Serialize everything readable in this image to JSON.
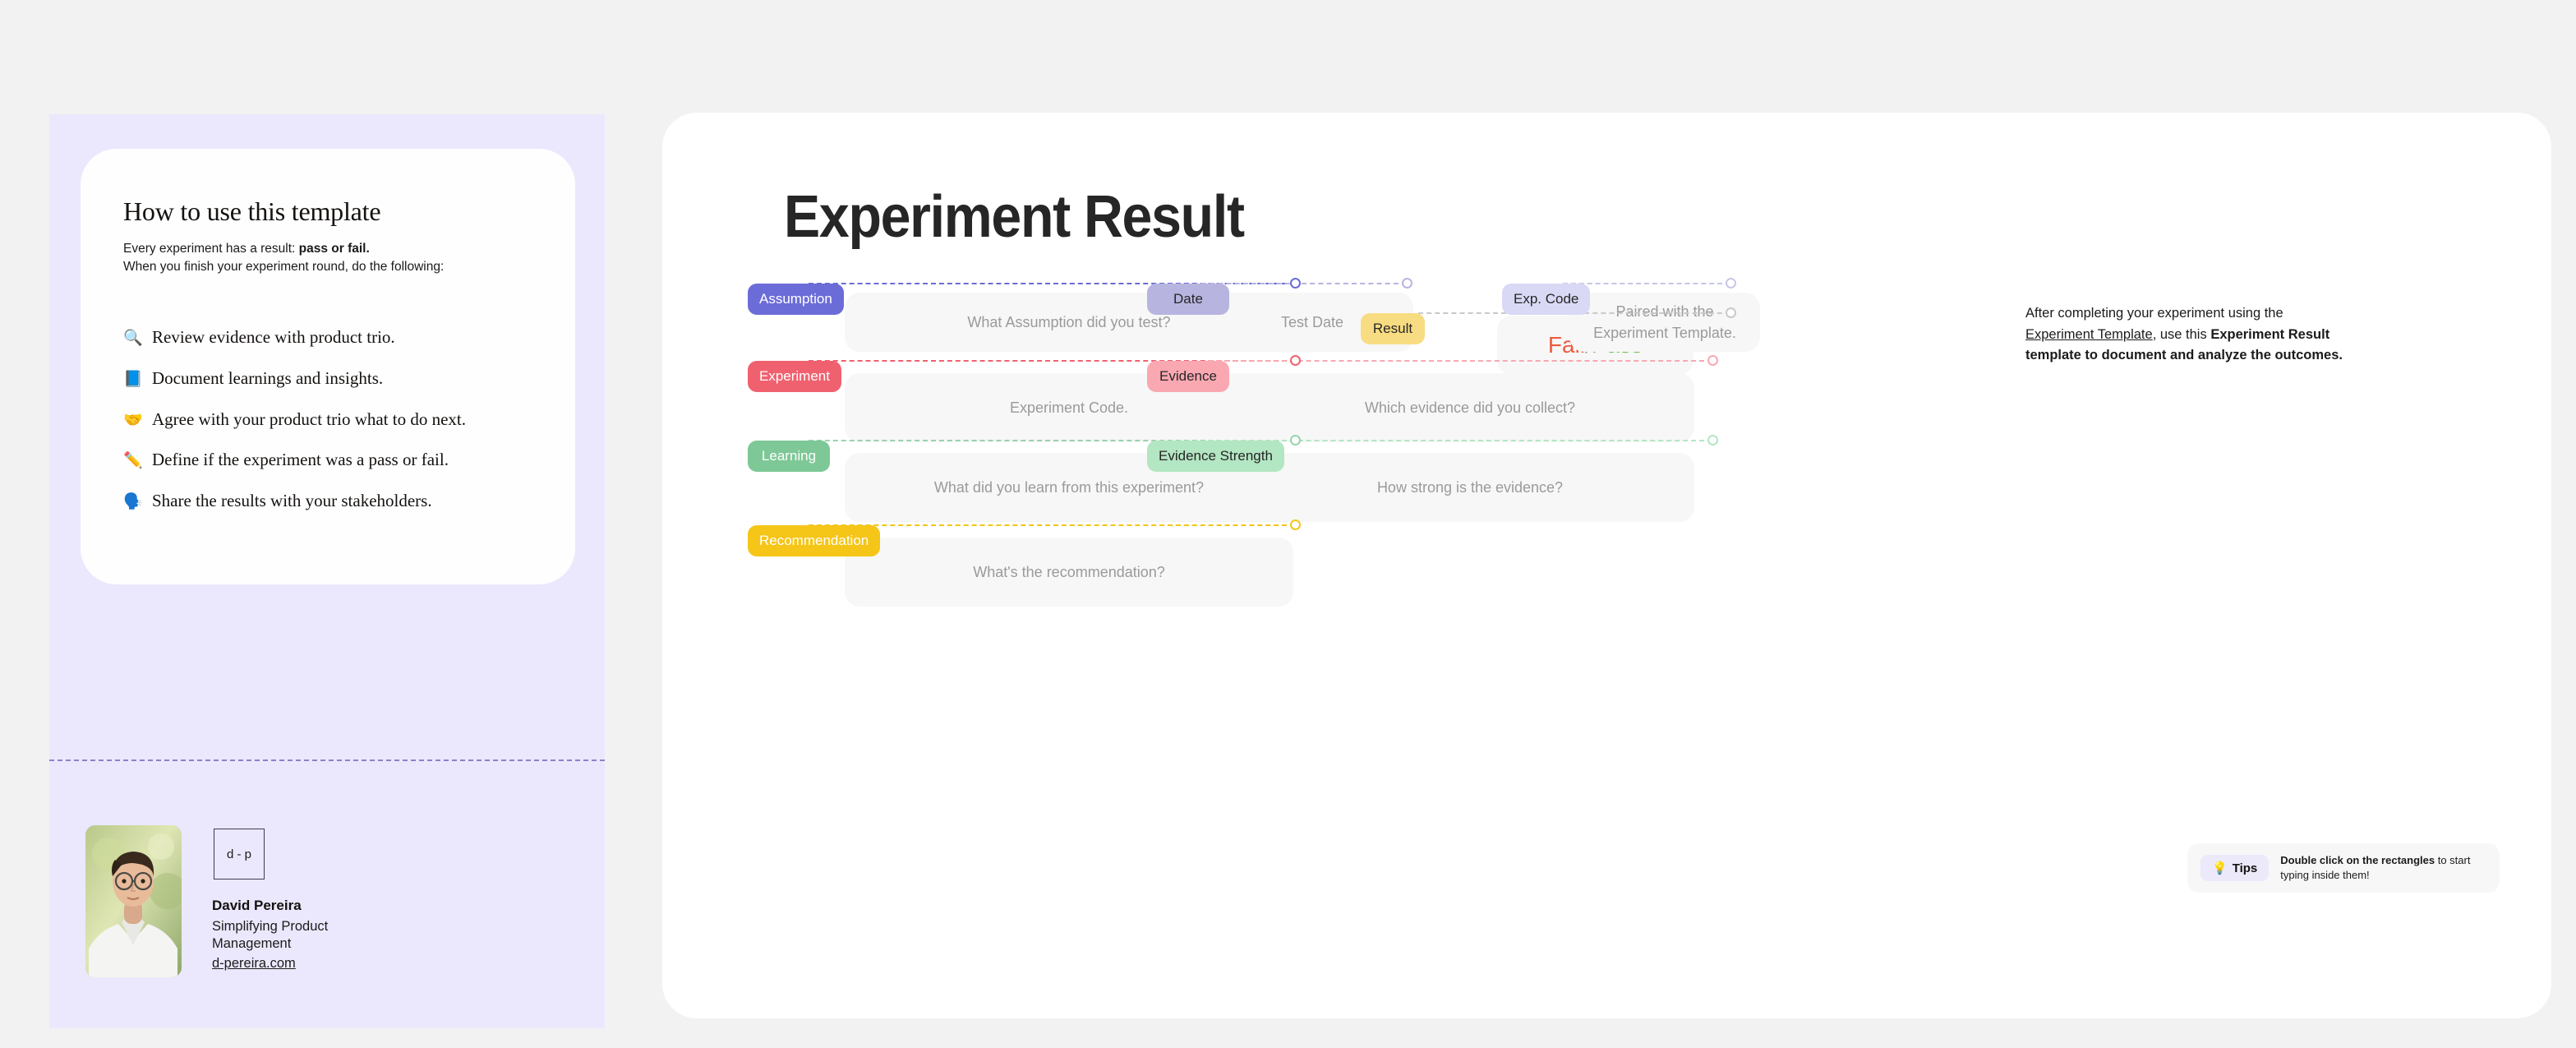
{
  "left_panel": {
    "howto": {
      "title": "How to use this template",
      "sub_line1_prefix": "Every experiment has a result: ",
      "sub_line1_bold": "pass or fail.",
      "sub_line2": "When you finish your experiment round, do the following:",
      "steps": [
        {
          "emoji": "🔍",
          "icon_name": "magnifier-icon",
          "text": "Review evidence with product trio."
        },
        {
          "emoji": "📘",
          "icon_name": "blue-book-icon",
          "text": "Document learnings and insights."
        },
        {
          "emoji": "🤝",
          "icon_name": "handshake-icon",
          "text": "Agree with your product trio what to do next."
        },
        {
          "emoji": "✏️",
          "icon_name": "pencil-icon",
          "text": "Define if the experiment was a pass or fail."
        },
        {
          "emoji": "🗣️",
          "icon_name": "speaking-head-icon",
          "text": "Share the results with your stakeholders."
        }
      ]
    },
    "author": {
      "logo_text": "d - p",
      "name": "David Pereira",
      "role": "Simplifying Product Management",
      "link": "d-pereira.com"
    }
  },
  "main": {
    "title": "Experiment Result",
    "intro": {
      "line1": "After completing your experiment using the",
      "link": "Experiment Template",
      "mid": ", use this ",
      "bold1": "Experiment Result",
      "bold2": "template to document and analyze the outcomes."
    },
    "result": {
      "label": "Result",
      "fail": "Fail",
      "separator": "/",
      "pass": "Pass"
    },
    "fields": [
      {
        "id": "assumption",
        "label": "Assumption",
        "placeholder": "What Assumption did you test?",
        "pill_bg": "#6c6cd8",
        "pill_color": "#ffffff",
        "line_color": "#6c6cd8",
        "column": "left",
        "row": 1
      },
      {
        "id": "date",
        "label": "Date",
        "placeholder": "Test Date",
        "pill_bg": "#b8b4e0",
        "pill_color": "#262626",
        "line_color": "#b8b4e0",
        "column": "right-a",
        "row": 1
      },
      {
        "id": "exp-code",
        "label": "Exp. Code",
        "placeholder": "Paired with the Experiment Template.",
        "pill_bg": "#d9d9f5",
        "pill_color": "#262626",
        "line_color": "#c7c7e8",
        "column": "right-b",
        "row": 1
      },
      {
        "id": "experiment",
        "label": "Experiment",
        "placeholder": "Experiment Code.",
        "pill_bg": "#f0616f",
        "pill_color": "#ffffff",
        "line_color": "#f0616f",
        "column": "left",
        "row": 2
      },
      {
        "id": "evidence",
        "label": "Evidence",
        "placeholder": "Which evidence did you collect?",
        "pill_bg": "#f9a8b2",
        "pill_color": "#262626",
        "line_color": "#f9a8b2",
        "column": "right",
        "row": 2
      },
      {
        "id": "learning",
        "label": "Learning",
        "placeholder": "What did you learn from this experiment?",
        "pill_bg": "#7dc896",
        "pill_color": "#ffffff",
        "line_color": "#9ad3ae",
        "column": "left",
        "row": 3
      },
      {
        "id": "evidence-strength",
        "label": "Evidence Strength",
        "placeholder": "How strong is the evidence?",
        "pill_bg": "#b3e6c2",
        "pill_color": "#262626",
        "line_color": "#b3e6c2",
        "column": "right",
        "row": 3
      },
      {
        "id": "recommendation",
        "label": "Recommendation",
        "placeholder": "What's the recommendation?",
        "pill_bg": "#f5c518",
        "pill_color": "#ffffff",
        "line_color": "#f5c518",
        "column": "left",
        "row": 4
      }
    ],
    "tips": {
      "emoji": "💡",
      "label": "Tips",
      "bold": "Double click on the rectangles",
      "rest": " to start typing inside them!"
    }
  },
  "colors": {
    "page_bg": "#f2f2f2",
    "canvas_bg": "#ffffff",
    "left_panel_bg": "#ebe8fd",
    "field_bg": "#f7f7f7",
    "result_label_bg": "#f8dc82",
    "fail": "#ec5b3d",
    "pass": "#7cc15c"
  }
}
